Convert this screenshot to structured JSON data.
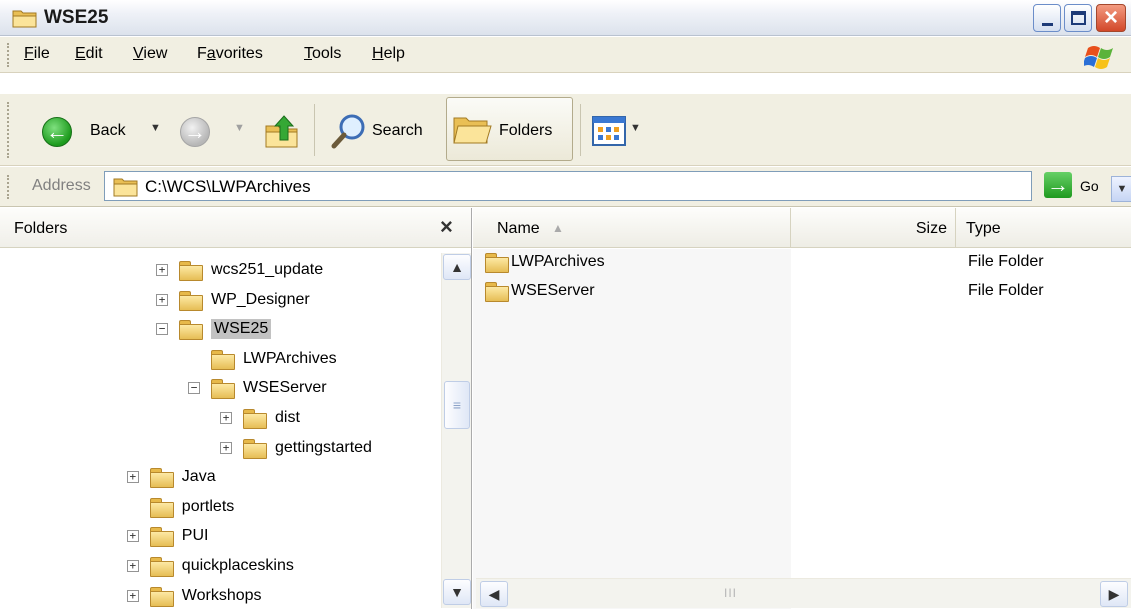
{
  "window": {
    "title": "WSE25",
    "icon": "folder-icon"
  },
  "menu": {
    "items": [
      {
        "label": "File",
        "underline_index": 0
      },
      {
        "label": "Edit",
        "underline_index": 0
      },
      {
        "label": "View",
        "underline_index": 0
      },
      {
        "label": "Favorites",
        "underline_index": 1
      },
      {
        "label": "Tools",
        "underline_index": 0
      },
      {
        "label": "Help",
        "underline_index": 0
      }
    ]
  },
  "toolbar": {
    "back_label": "Back",
    "search_label": "Search",
    "folders_label": "Folders"
  },
  "address": {
    "label": "Address",
    "value": "C:\\WCS\\LWPArchives",
    "go_label": "Go"
  },
  "folder_pane": {
    "title": "Folders",
    "close_glyph": "×",
    "tree": [
      {
        "label": "wcs251_update",
        "expander": "+",
        "depth": 0
      },
      {
        "label": "WP_Designer",
        "expander": "+",
        "depth": 0
      },
      {
        "label": "WSE25",
        "expander": "−",
        "depth": 0,
        "selected": true
      },
      {
        "label": "LWPArchives",
        "expander": "",
        "depth": 1
      },
      {
        "label": "WSEServer",
        "expander": "−",
        "depth": 1
      },
      {
        "label": "dist",
        "expander": "+",
        "depth": 2
      },
      {
        "label": "gettingstarted",
        "expander": "+",
        "depth": 2
      },
      {
        "label": "Java",
        "expander": "+",
        "depth": -1
      },
      {
        "label": "portlets",
        "expander": "",
        "depth": -1
      },
      {
        "label": "PUI",
        "expander": "+",
        "depth": -1
      },
      {
        "label": "quickplaceskins",
        "expander": "+",
        "depth": -1
      },
      {
        "label": "Workshops",
        "expander": "+",
        "depth": -1
      }
    ]
  },
  "file_list": {
    "columns": {
      "name": "Name",
      "size": "Size",
      "type": "Type"
    },
    "rows": [
      {
        "name": "LWPArchives",
        "size": "",
        "type": "File Folder"
      },
      {
        "name": "WSEServer",
        "size": "",
        "type": "File Folder"
      }
    ]
  }
}
